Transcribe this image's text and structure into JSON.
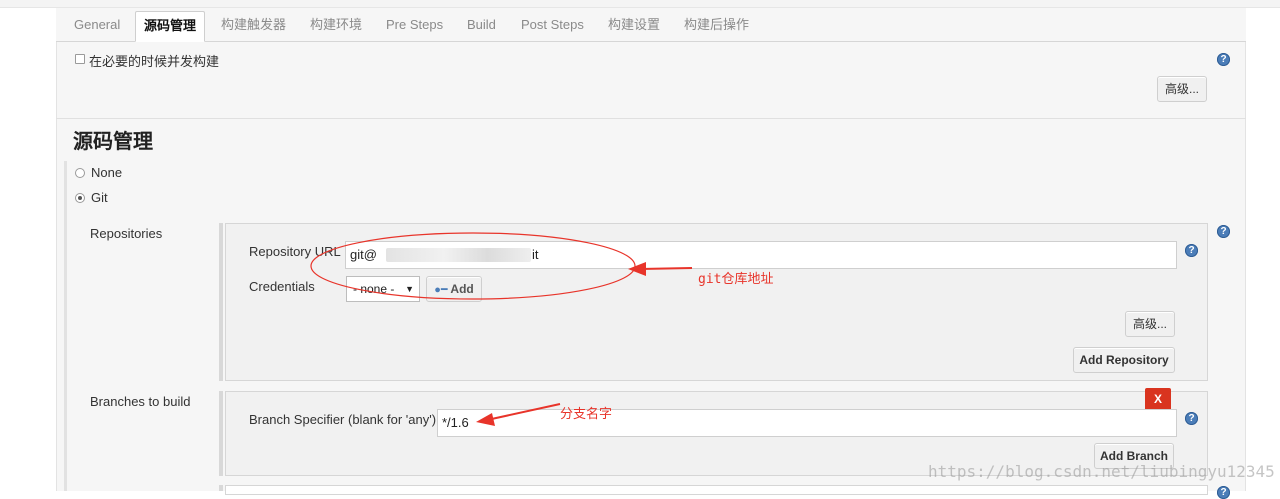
{
  "tabs": [
    "General",
    "源码管理",
    "构建触发器",
    "构建环境",
    "Pre Steps",
    "Build",
    "Post Steps",
    "构建设置",
    "构建后操作"
  ],
  "active_tab": "源码管理",
  "concurrent_build": {
    "label": "在必要的时候并发构建",
    "checked": false
  },
  "advanced_label_top": "高级...",
  "section_title": "源码管理",
  "scm_options": {
    "none": "None",
    "git": "Git",
    "selected": "Git"
  },
  "repositories": {
    "label": "Repositories",
    "url_label": "Repository URL",
    "url_prefix": "git@",
    "url_suffix": "it",
    "credentials_label": "Credentials",
    "credentials_value": "- none -",
    "add_label": "Add",
    "advanced_label": "高级...",
    "add_repository_label": "Add Repository"
  },
  "branches": {
    "label": "Branches to build",
    "specifier_label": "Branch Specifier (blank for 'any')",
    "specifier_value": "*/1.6",
    "delete_label": "X",
    "add_branch_label": "Add Branch"
  },
  "annotations": {
    "git_repo": "git仓库地址",
    "branch_name": "分支名字"
  },
  "help_glyph": "?",
  "watermark": "https://blog.csdn.net/liubingyu12345",
  "colors": {
    "annotation_red": "#e8342a",
    "help_blue": "#4b7db8",
    "delete_red": "#d9341f"
  },
  "icons": {
    "add_key": "key-icon",
    "select": "chevron-down-icon",
    "help": "help-icon"
  }
}
